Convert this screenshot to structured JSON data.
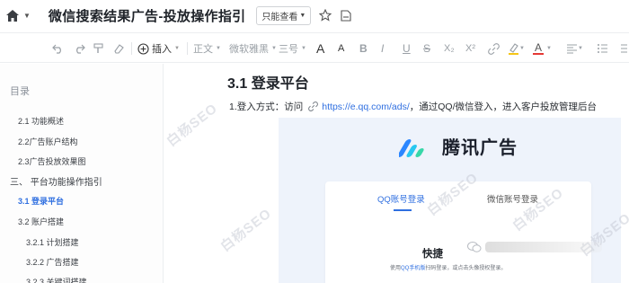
{
  "header": {
    "doc_title": "微信搜索结果广告-投放操作指引",
    "permission_label": "只能查看"
  },
  "toolbar": {
    "insert_label": "插入",
    "style_label": "正文",
    "font_label": "微软雅黑",
    "size_label": "三号",
    "font_a1": "A",
    "font_a2": "A",
    "bold": "B",
    "italic": "I",
    "underline": "U",
    "strike": "S",
    "subscript": "X₂",
    "superscript": "X²",
    "text_color_letter": "A",
    "colors": {
      "highlight": "#f5c518",
      "text_color": "#e53935"
    }
  },
  "sidebar": {
    "title": "目录",
    "items": [
      {
        "label": "2.1  功能概述"
      },
      {
        "label": "2.2广告账户结构"
      },
      {
        "label": "2.3广告投放效果图"
      },
      {
        "label": "三、  平台功能操作指引"
      },
      {
        "label": "3.1  登录平台"
      },
      {
        "label": "3.2  账户搭建"
      },
      {
        "label": "3.2.1  计划搭建"
      },
      {
        "label": "3.2.2  广告搭建"
      },
      {
        "label": "3.2.3  关键词搭建"
      }
    ]
  },
  "main": {
    "heading": "3.1 登录平台",
    "para_prefix": "1.登入方式：访问",
    "link": "https://e.qq.com/ads/",
    "para_suffix": "，通过QQ/微信登入，进入客户投放管理后台"
  },
  "embed": {
    "brand_name": "腾讯广告",
    "tab_qq": "QQ账号登录",
    "tab_wechat": "微信账号登录",
    "scan_title": "快捷",
    "scan_desc_link": "QQ手机版",
    "scan_desc_pre": "使用",
    "scan_desc_post": "扫码登录，或点击头像授权登录。"
  },
  "watermark": "白杨SEO"
}
